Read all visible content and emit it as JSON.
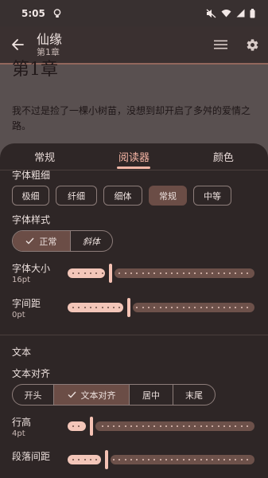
{
  "status_bar": {
    "time": "5:05"
  },
  "app_bar": {
    "title": "仙缘",
    "subtitle": "第1章"
  },
  "reader": {
    "chapter_heading": "第1章",
    "paragraph": "我不过是捡了一棵小树苗，没想到却开启了多舛的爱情之路。"
  },
  "sheet": {
    "tabs": [
      {
        "label": "常规",
        "active": false
      },
      {
        "label": "阅读器",
        "active": true
      },
      {
        "label": "颜色",
        "active": false
      }
    ],
    "font_weight": {
      "label": "字体粗细",
      "options": [
        "极细",
        "纤细",
        "细体",
        "常规",
        "中等"
      ],
      "selected": "常规"
    },
    "font_style": {
      "label": "字体样式",
      "options": [
        "正常",
        "斜体"
      ],
      "selected": "正常"
    },
    "font_size": {
      "label": "字体大小",
      "value_text": "16pt",
      "fraction": 0.22
    },
    "letter_spacing": {
      "label": "字间距",
      "value_text": "0pt",
      "fraction": 0.32
    },
    "text_section": {
      "heading": "文本",
      "alignment": {
        "label": "文本对齐",
        "options": [
          "开头",
          "文本对齐",
          "居中",
          "末尾"
        ],
        "selected": "文本对齐"
      },
      "line_height": {
        "label": "行高",
        "value_text": "4pt",
        "fraction": 0.12
      },
      "paragraph_spacing": {
        "label": "段落间距",
        "fraction": 0.2
      }
    }
  },
  "colors": {
    "accent": "#f0b6a6",
    "selected_chip": "#6b4d46",
    "sheet_bg": "#2e2626"
  }
}
